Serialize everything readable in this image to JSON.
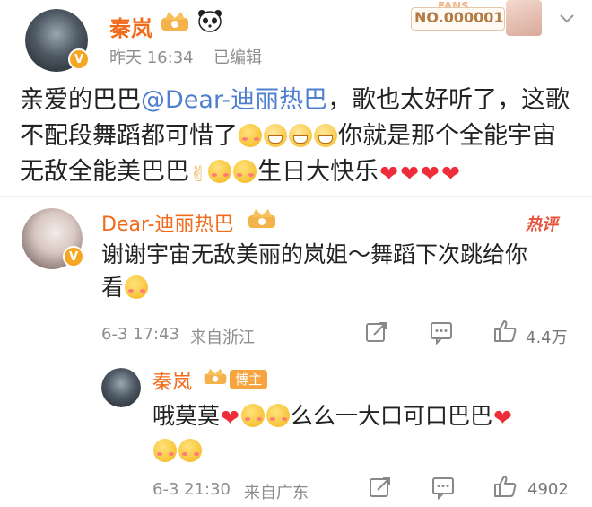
{
  "post": {
    "author": "秦岚",
    "time": "昨天 16:34",
    "edited": "已编辑",
    "text_line1_a": "亲爱的巴巴",
    "text_line1_mention": "@Dear-迪丽热巴",
    "text_line1_b": "，歌也太好听了，这歌",
    "text_line2_a": "不配段舞蹈都可惜了",
    "text_line2_b": "你就是那个全能宇宙",
    "text_line3_a": "无敌全能美巴巴",
    "text_line3_b": "生日大快乐",
    "fans_badge": "NO.000001",
    "fans_label": "FANS"
  },
  "comment1": {
    "author": "Dear-迪丽热巴",
    "tag": "热评",
    "text": "谢谢宇宙无敌美丽的岚姐～舞蹈下次跳给你看",
    "text_line1": "谢谢宇宙无敌美丽的岚姐～舞蹈下次跳给你",
    "text_line2": "看",
    "date": "6-3 17:43",
    "location": "来自浙江",
    "likes": "4.4万"
  },
  "reply1": {
    "author": "秦岚",
    "badge": "博主",
    "text_a": "哦莫莫",
    "text_b": "么么一大口可口巴巴",
    "date": "6-3 21:30",
    "location": "来自广东",
    "likes": "4902"
  },
  "icons": [
    "crown-icon",
    "panda-icon",
    "verified-icon",
    "share-icon",
    "comment-icon",
    "like-icon",
    "chevron-down-icon"
  ],
  "colors": {
    "name": "#f26a1b",
    "mention": "#4f7fcf",
    "meta": "#8d8d8d",
    "heart": "#ee2d3a",
    "hot": "#e9533b"
  }
}
